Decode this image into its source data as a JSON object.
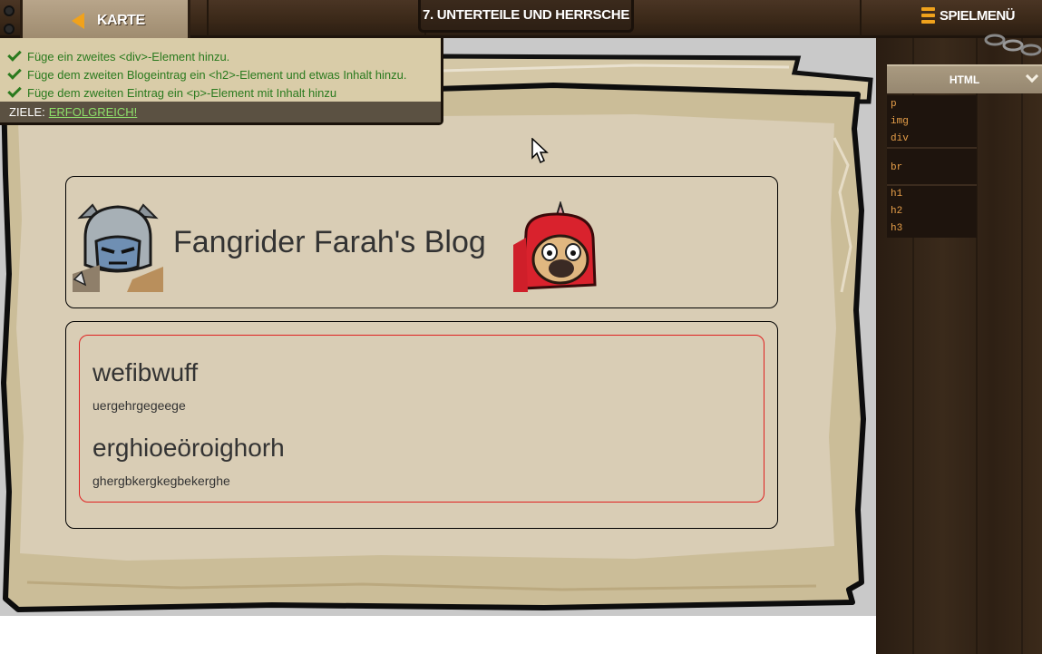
{
  "topbar": {
    "back_label": "KARTE",
    "level_title": "7. UNTERTEILE UND HERRSCHE",
    "menu_label": "SPIELMENÜ"
  },
  "goals": {
    "items": [
      "Füge ein zweites <div>-Element hinzu.",
      "Füge dem zweiten Blogeintrag ein <h2>-Element und etwas Inhalt hinzu.",
      "Füge dem zweiten Eintrag ein <p>-Element mit Inhalt hinzu"
    ],
    "status_label": "ZIELE:",
    "status_value": "ERFOLGREICH!"
  },
  "blog": {
    "title": "Fangrider Farah's Blog",
    "posts": [
      {
        "heading": "wefibwuff",
        "text": "uergehrgegeege"
      },
      {
        "heading": "erghioeöroighorh",
        "text": "ghergbkergkegbekerghe"
      }
    ]
  },
  "palette": {
    "tab_label": "HTML",
    "snippets": [
      "p",
      "img",
      "div",
      "br",
      "h1",
      "h2",
      "h3"
    ]
  },
  "colors": {
    "goal_green": "#2a7a1e",
    "success_green": "#8ee06a",
    "accent_orange": "#f0a21c",
    "parchment": "#d9cdb5",
    "snippet_orange": "#e8a04a"
  }
}
